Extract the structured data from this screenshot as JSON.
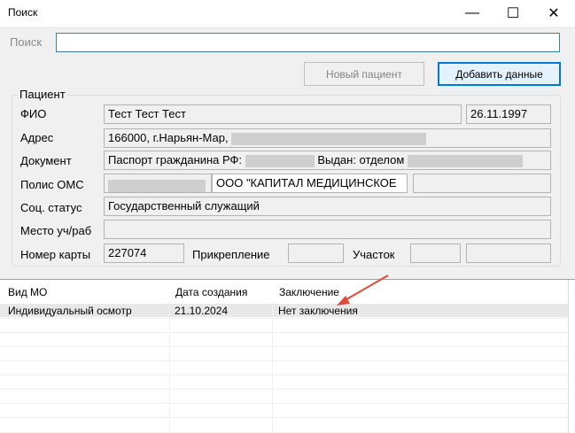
{
  "window": {
    "title": "Поиск",
    "minimize": "—",
    "maximize": "☐",
    "close": "✕"
  },
  "search": {
    "label": "Поиск",
    "value": ""
  },
  "buttons": {
    "new_patient": "Новый пациент",
    "add_data": "Добавить данные"
  },
  "patient": {
    "group_title": "Пациент",
    "labels": {
      "fio": "ФИО",
      "address": "Адрес",
      "document": "Документ",
      "policy": "Полис ОМС",
      "social": "Соц. статус",
      "work": "Место уч/раб",
      "card": "Номер карты",
      "attach": "Прикрепление",
      "district": "Участок"
    },
    "fio": "Тест Тест Тест",
    "birth_date": "26.11.1997",
    "address": "166000, г.Нарьян-Мар,",
    "document_start": "Паспорт гражданина РФ:",
    "document_issued": "Выдан: отделом",
    "policy_org": "ООО \"КАПИТАЛ МЕДИЦИНСКОЕ",
    "social_status": "Государственный служащий",
    "work_place": "",
    "card_number": "227074",
    "attachment": "",
    "district": "",
    "district_extra": ""
  },
  "grid": {
    "columns": [
      "Вид МО",
      "Дата создания",
      "Заключение"
    ],
    "rows": [
      {
        "type": "Индивидуальный осмотр",
        "date": "21.10.2024",
        "conclusion": "Нет заключения"
      }
    ]
  },
  "colors": {
    "accent": "#0078d7",
    "arrow": "#e04a3a",
    "selected_row": "#e8e8e8"
  }
}
